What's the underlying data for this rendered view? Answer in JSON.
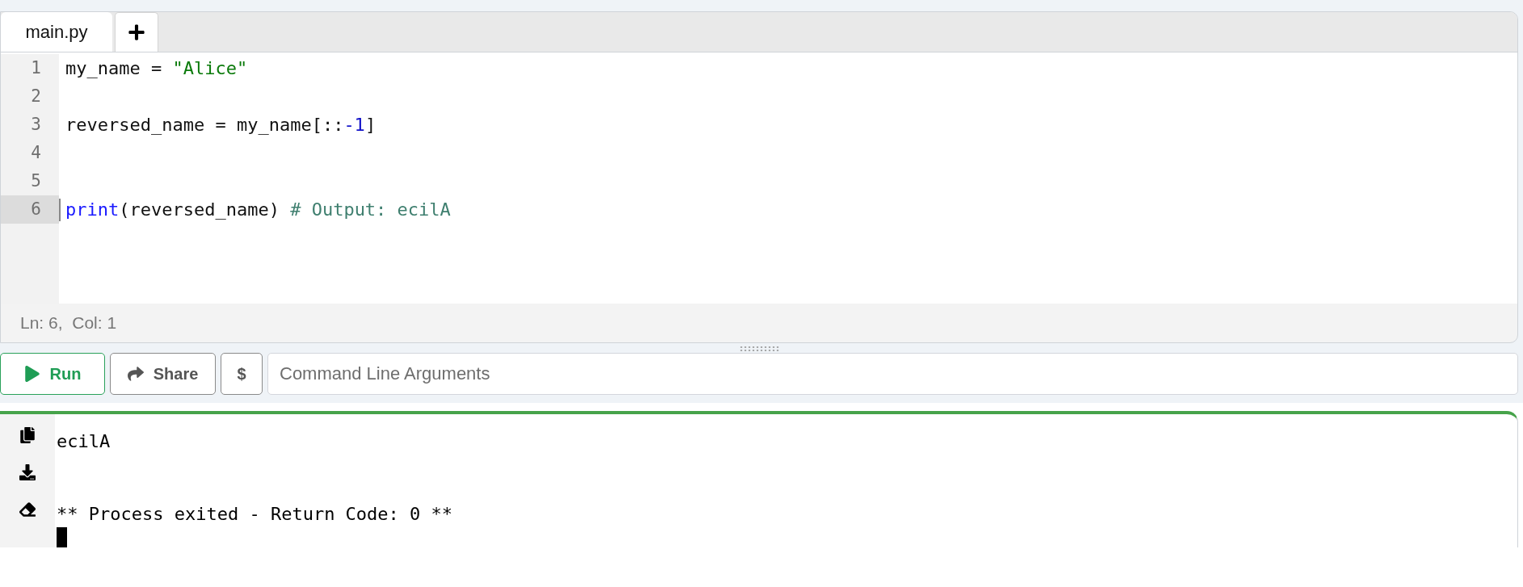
{
  "tabs": [
    {
      "label": "main.py",
      "selected": true
    }
  ],
  "editor": {
    "lines": [
      {
        "number": "1",
        "current": false,
        "tokens": [
          {
            "text": "my_name = ",
            "kind": "plain"
          },
          {
            "text": "\"Alice\"",
            "kind": "string"
          }
        ]
      },
      {
        "number": "2",
        "current": false
      },
      {
        "number": "3",
        "current": false,
        "tokens": [
          {
            "text": "reversed_name = my_name[::",
            "kind": "plain"
          },
          {
            "text": "-1",
            "kind": "number"
          },
          {
            "text": "]",
            "kind": "plain"
          }
        ]
      },
      {
        "number": "4",
        "current": false
      },
      {
        "number": "5",
        "current": false
      },
      {
        "number": "6",
        "current": true,
        "tokens": [
          {
            "text": "print",
            "kind": "keyword"
          },
          {
            "text": "(reversed_name) ",
            "kind": "plain"
          },
          {
            "text": "# Output: ecilA",
            "kind": "comment"
          }
        ]
      }
    ],
    "status": "Ln: 6,  Col: 1"
  },
  "toolbar": {
    "run": "Run",
    "share": "Share",
    "dollar": "$",
    "arguments_placeholder": "Command Line Arguments"
  },
  "terminal": {
    "output": [
      "ecilA"
    ],
    "exit_message": "** Process exited - Return Code: 0 **"
  }
}
